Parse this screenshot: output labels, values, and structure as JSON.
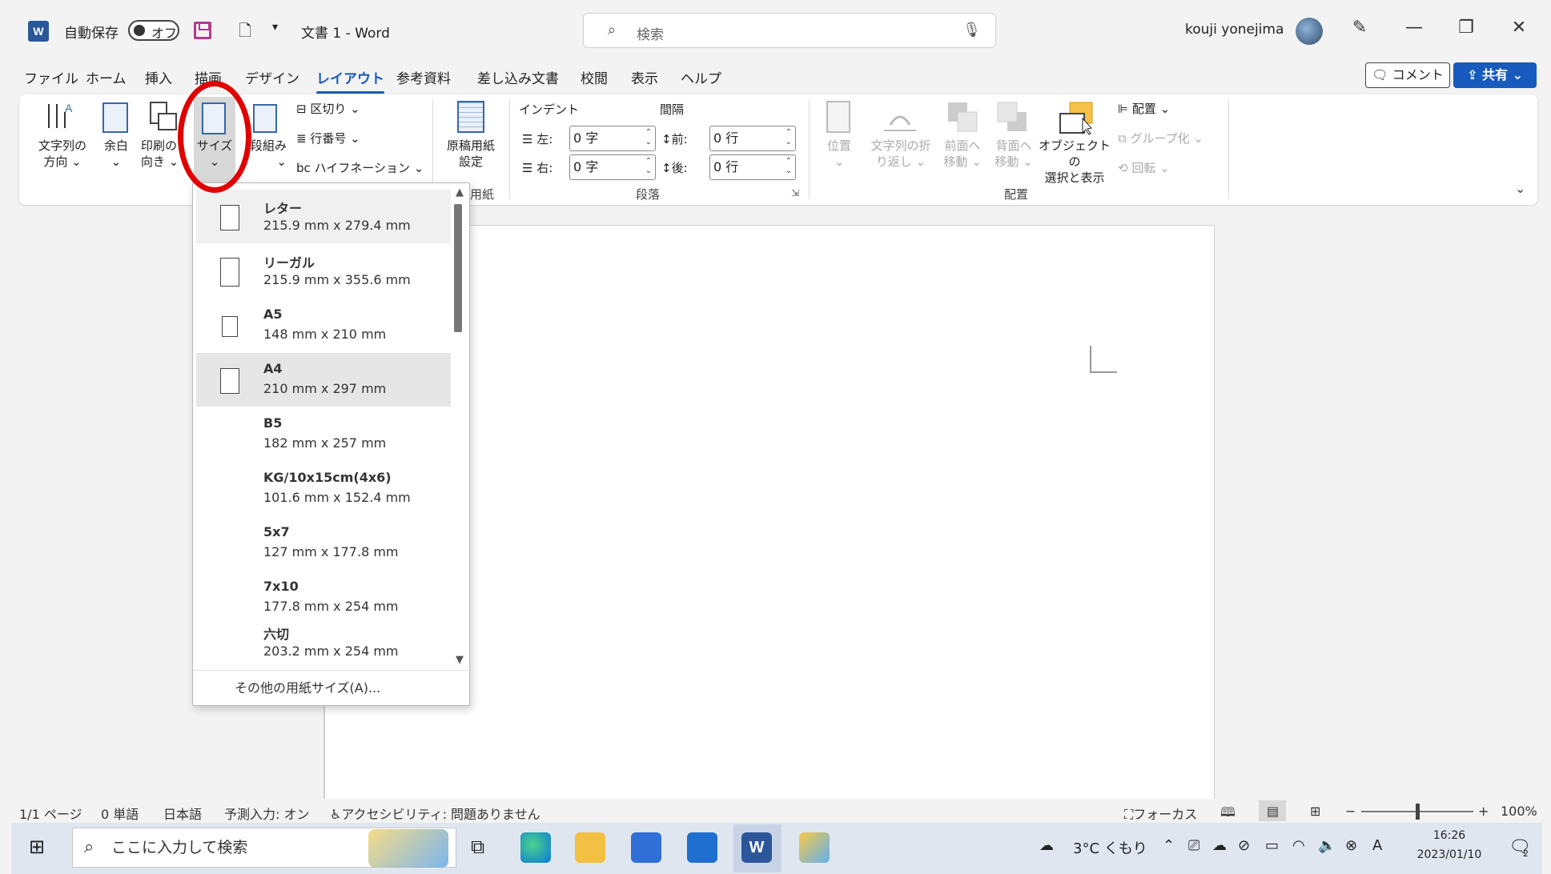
{
  "titlebar": {
    "autosave_label": "自動保存",
    "autosave_state": "オフ",
    "doc_title": "文書 1 - Word",
    "search_placeholder": "検索",
    "user_name": "kouji yonejima"
  },
  "tabs": [
    "ファイル",
    "ホーム",
    "挿入",
    "描画",
    "デザイン",
    "レイアウト",
    "参考資料",
    "差し込み文書",
    "校閲",
    "表示",
    "ヘルプ"
  ],
  "active_tab": "レイアウト",
  "header_buttons": {
    "comment": "コメント",
    "share": "共有"
  },
  "ribbon": {
    "text_direction": [
      "文字列の",
      "方向"
    ],
    "margins": "余白",
    "orientation": [
      "印刷の",
      "向き"
    ],
    "size": "サイズ",
    "columns": "段組み",
    "breaks": "区切り",
    "line_numbers": "行番号",
    "hyphenation": "ハイフネーション",
    "manuscript": [
      "原稿用紙",
      "設定"
    ],
    "manuscript_group": "用紙",
    "indent_title": "インデント",
    "spacing_title": "間隔",
    "indent_left_label": "左:",
    "indent_left_value": "0 字",
    "indent_right_label": "右:",
    "indent_right_value": "0 字",
    "spacing_before_label": "前:",
    "spacing_before_value": "0 行",
    "spacing_after_label": "後:",
    "spacing_after_value": "0 行",
    "paragraph_group": "段落",
    "position": "位置",
    "wrap_text": [
      "文字列の折",
      "り返し"
    ],
    "bring_forward": [
      "前面へ",
      "移動"
    ],
    "send_backward": [
      "背面へ",
      "移動"
    ],
    "selection_pane": [
      "オブジェクトの",
      "選択と表示"
    ],
    "align": "配置",
    "group": "グループ化",
    "rotate": "回転",
    "arrange_group": "配置"
  },
  "size_menu": {
    "items": [
      {
        "name": "レター",
        "dims": "215.9 mm x 279.4 mm"
      },
      {
        "name": "リーガル",
        "dims": "215.9 mm x 355.6 mm"
      },
      {
        "name": "A5",
        "dims": "148 mm x 210 mm"
      },
      {
        "name": "A4",
        "dims": "210 mm x 297 mm"
      },
      {
        "name": "B5",
        "dims": "182 mm x 257 mm"
      },
      {
        "name": "KG/10x15cm(4x6)",
        "dims": "101.6 mm x 152.4 mm"
      },
      {
        "name": "5x7",
        "dims": "127 mm x 177.8 mm"
      },
      {
        "name": "7x10",
        "dims": "177.8 mm x 254 mm"
      },
      {
        "name": "六切",
        "dims": "203.2 mm x 254 mm"
      }
    ],
    "selected": "A4",
    "more_sizes": "その他の用紙サイズ(A)..."
  },
  "statusbar": {
    "page": "1/1 ページ",
    "words": "0 単語",
    "language": "日本語",
    "predict": "予測入力: オン",
    "accessibility": "アクセシビリティ: 問題ありません",
    "focus": "フォーカス",
    "zoom": "100%"
  },
  "taskbar": {
    "search_placeholder": "ここに入力して検索",
    "weather": "3°C くもり",
    "time": "16:26",
    "date": "2023/01/10",
    "notifications": "2"
  }
}
